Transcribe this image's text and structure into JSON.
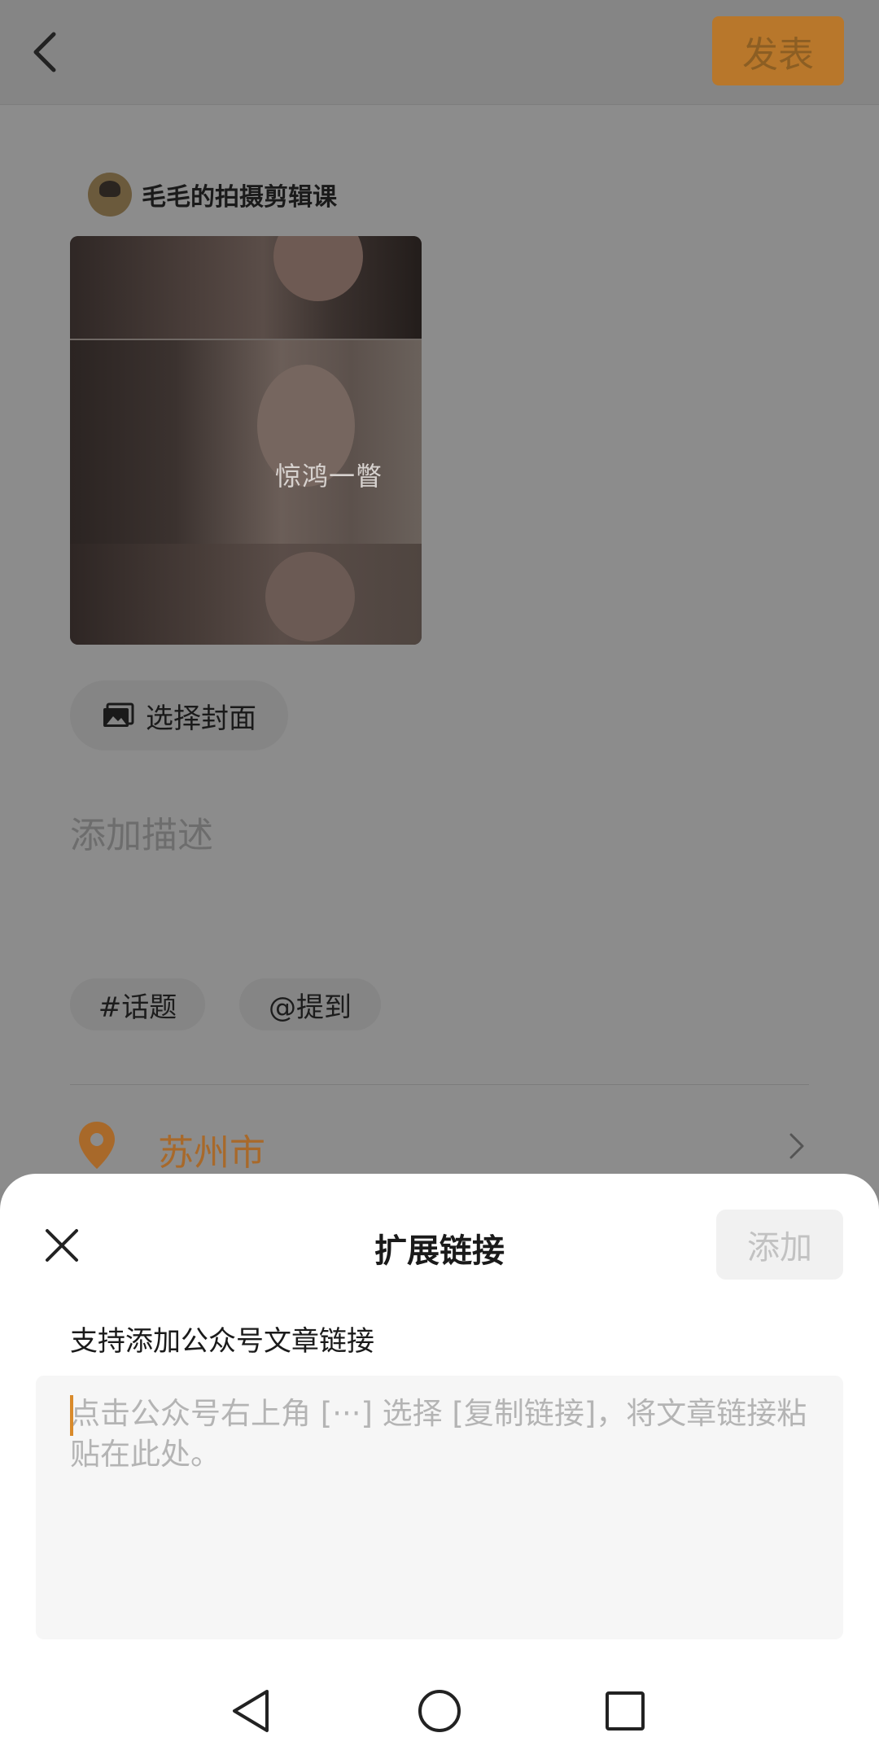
{
  "header": {
    "publish_label": "发表"
  },
  "author": {
    "name": "毛毛的拍摄剪辑课"
  },
  "video": {
    "caption": "惊鸿一瞥"
  },
  "cover_button": {
    "label": "选择封面"
  },
  "description": {
    "placeholder": "添加描述"
  },
  "chips": {
    "topic": "#话题",
    "mention": "@提到"
  },
  "location": {
    "city": "苏州市"
  },
  "sheet": {
    "title": "扩展链接",
    "add_label": "添加",
    "hint": "支持添加公众号文章链接",
    "input_placeholder": "点击公众号右上角 [···] 选择 [复制链接]，将文章链接粘贴在此处。"
  },
  "colors": {
    "accent": "#d98a2b",
    "sheet_bg": "#ffffff",
    "overlay": "#8c8c8c"
  },
  "icons": [
    "back-icon",
    "image-icon",
    "location-pin-icon",
    "chevron-right-icon",
    "close-icon",
    "nav-back-icon",
    "nav-home-icon",
    "nav-recents-icon"
  ]
}
